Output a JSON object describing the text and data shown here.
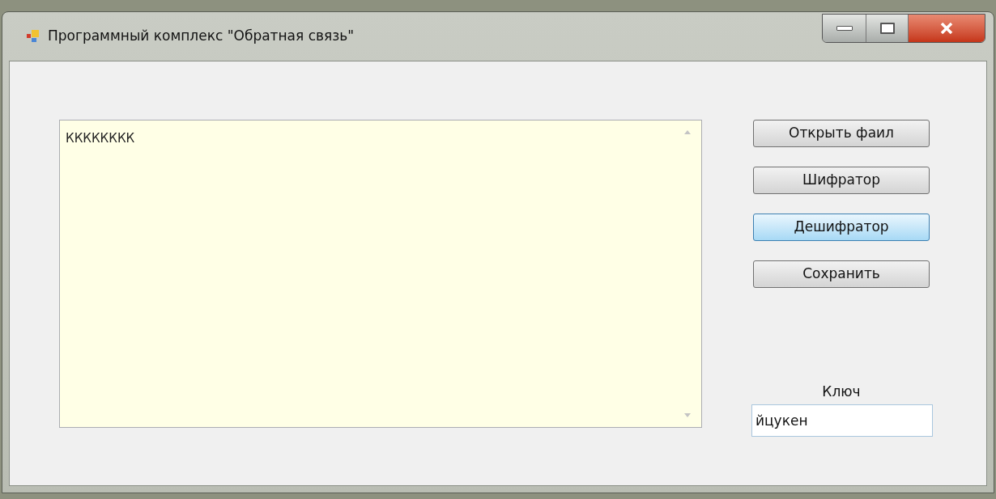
{
  "window": {
    "title": "Программный комплекс \"Обратная связь\""
  },
  "text_area": {
    "value": "КККККККК"
  },
  "buttons": [
    {
      "label": "Открыть фаил",
      "highlighted": false
    },
    {
      "label": "Шифратор",
      "highlighted": false
    },
    {
      "label": "Дешифратор",
      "highlighted": true
    },
    {
      "label": "Сохранить",
      "highlighted": false
    }
  ],
  "key_field": {
    "label": "Ключ",
    "value": "йцукен"
  }
}
